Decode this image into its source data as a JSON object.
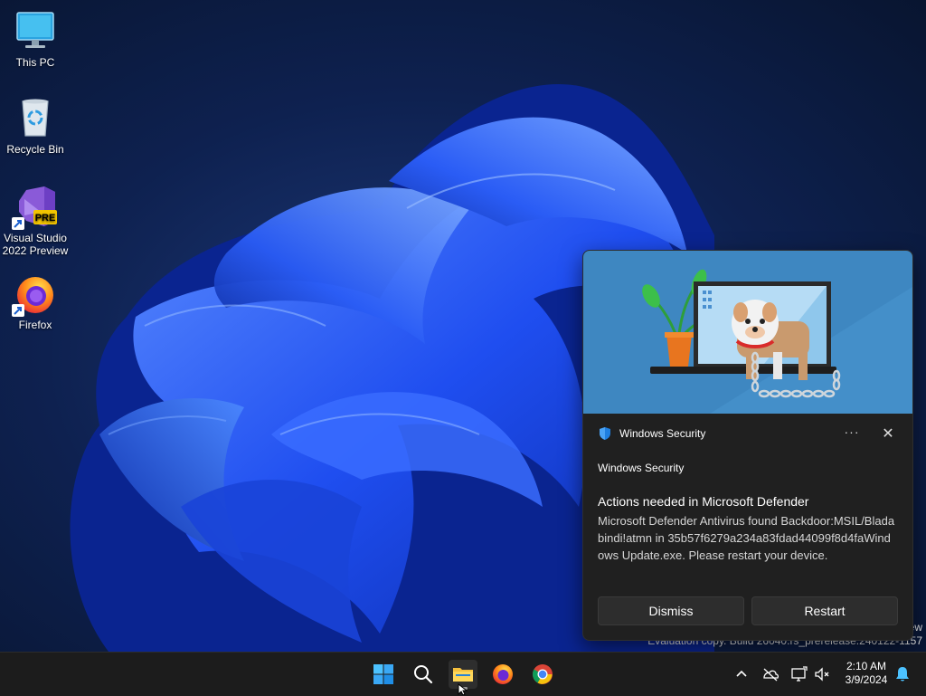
{
  "desktop": {
    "icons": [
      {
        "label": "This PC",
        "icon": "monitor-icon"
      },
      {
        "label": "Recycle Bin",
        "icon": "recycle-bin-icon"
      },
      {
        "label": "Visual Studio\n2022 Preview",
        "line1": "Visual Studio",
        "line2": "2022 Preview",
        "badge": "PRE",
        "icon": "visual-studio-icon"
      },
      {
        "label": "Firefox",
        "icon": "firefox-icon"
      }
    ]
  },
  "watermark": {
    "line1": "ew",
    "line2": "Evaluation copy. Build 26040.rs_prerelease.240122-1157"
  },
  "toast": {
    "app_name": "Windows Security",
    "more_glyph": "···",
    "close_glyph": "✕",
    "attribution": "Windows Security",
    "title": "Actions needed in Microsoft Defender",
    "body": "Microsoft Defender Antivirus found Backdoor:MSIL/Bladabindi!atmn in 35b57f6279a234a83fdad44099f8d4faWindows Update.exe. Please restart your device.",
    "buttons": {
      "dismiss": "Dismiss",
      "restart": "Restart"
    }
  },
  "taskbar": {
    "pinned": [
      "start-icon",
      "search-icon",
      "file-explorer-icon",
      "firefox-icon",
      "chrome-icon"
    ],
    "tray": [
      "chevron-up-icon",
      "network-disconnected-icon",
      "display-icon",
      "volume-muted-icon",
      "notification-bell-icon"
    ],
    "clock": {
      "time": "2:10 AM",
      "date": "3/9/2024"
    }
  },
  "colors": {
    "accent": "#0078d4",
    "toast_bg": "#202020",
    "taskbar_bg": "#1c1c1c",
    "hero_bg": "#3e87c1"
  }
}
